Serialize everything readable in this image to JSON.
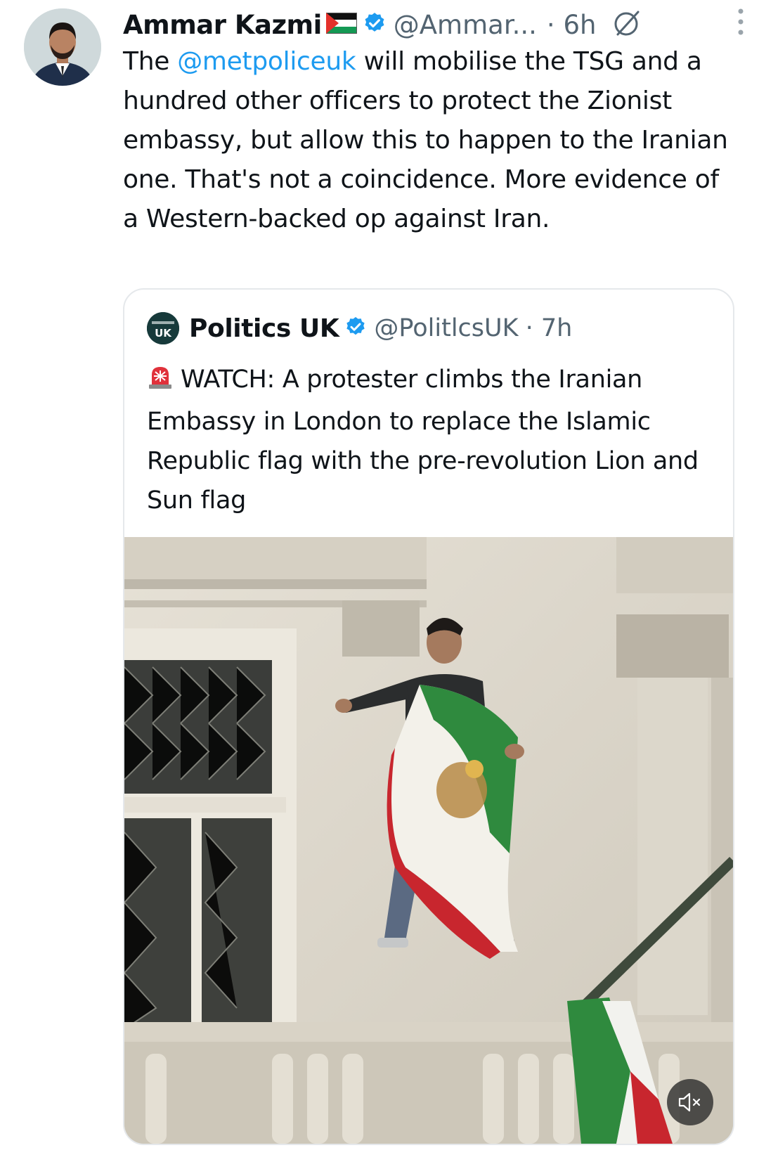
{
  "tweet": {
    "author_name": "Ammar Kazmi",
    "handle": "@Ammar...",
    "time": "· 6h",
    "text_before_mention": "The ",
    "mention": "@metpoliceuk",
    "text_after_mention": " will mobilise the TSG and a hundred other officers to protect the Zionist embassy, but allow this to happen to the Iranian one. That's not a coincidence. More evidence of a Western-backed op against Iran.",
    "icons": [
      "palestine-flag-icon",
      "verified-icon",
      "grok-icon",
      "more-options-icon"
    ]
  },
  "quote": {
    "author_name": "Politics UK",
    "avatar_text": "UK",
    "handle": "@PolitlcsUK",
    "time": "· 7h",
    "text": "WATCH: A protester climbs the Iranian Embassy in London to replace the Islamic Republic flag with the pre-revolution Lion and Sun flag",
    "icons": [
      "siren-icon",
      "verified-icon",
      "mute-icon"
    ]
  },
  "colors": {
    "link": "#1d9bf0",
    "secondary_text": "#536471",
    "verified": "#1d9bf0",
    "border": "#e5e8eb"
  }
}
